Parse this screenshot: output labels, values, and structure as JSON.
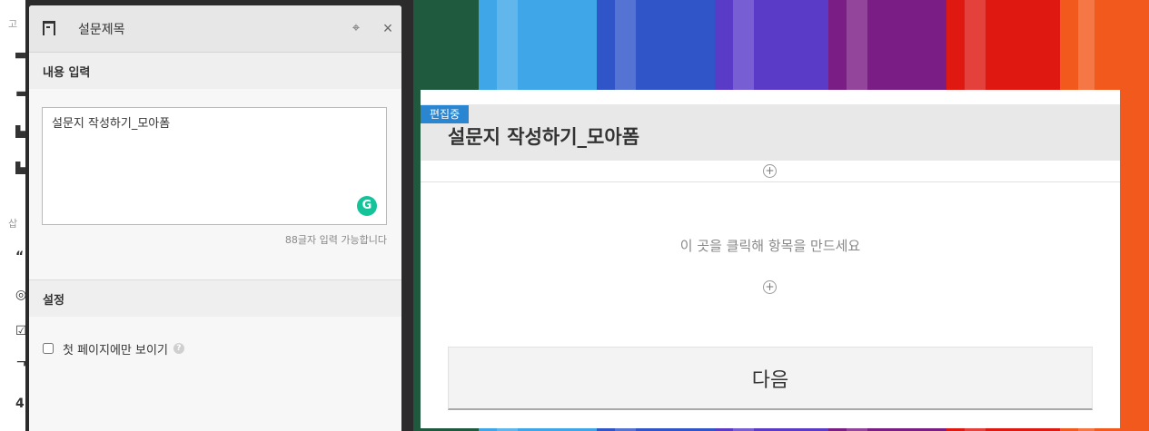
{
  "left_strip": {
    "labels": [
      "고",
      "삽"
    ]
  },
  "panel": {
    "title": "설문제목",
    "icons": {
      "title": "title-block-icon",
      "target": "crosshair-icon",
      "close": "close-icon"
    },
    "content_section": {
      "title": "내용 입력",
      "textarea_value": "설문지 작성하기_모아폼",
      "grammarly_glyph": "G",
      "char_count": "88글자 입력 가능합니다"
    },
    "settings_section": {
      "title": "설정",
      "first_page_only": {
        "label": "첫 페이지에만 보이기",
        "checked": false
      },
      "help_glyph": "?"
    }
  },
  "preview": {
    "editing_badge": "편집중",
    "title": "설문지 작성하기_모아폼",
    "add_glyph": "+",
    "empty_hint": "이 곳을 클릭해 항목을 만드세요",
    "next_label": "다음"
  },
  "colors": {
    "badge": "#2b86d1",
    "grammarly": "#15c39a",
    "panel_bg": "#f7f7f7"
  }
}
